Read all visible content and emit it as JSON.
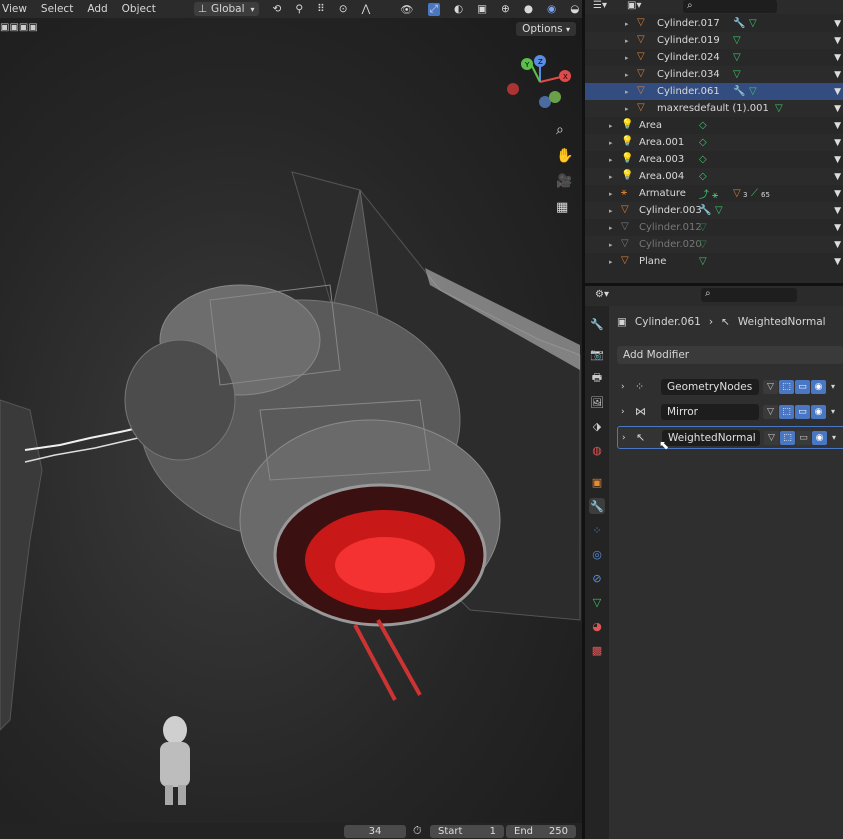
{
  "viewport": {
    "menu": [
      "View",
      "Select",
      "Add",
      "Object"
    ],
    "orientation": "Global",
    "options_label": "Options",
    "gizmo_axes": [
      "Y",
      "Z",
      "X"
    ]
  },
  "timeline": {
    "current_frame": "34",
    "start_label": "Start",
    "start_value": "1",
    "end_label": "End",
    "end_value": "250"
  },
  "outliner": {
    "rows": [
      {
        "label": "Cylinder.017",
        "type": "mesh",
        "extras": "wrench"
      },
      {
        "label": "Cylinder.019",
        "type": "mesh",
        "extras": ""
      },
      {
        "label": "Cylinder.024",
        "type": "mesh",
        "extras": ""
      },
      {
        "label": "Cylinder.034",
        "type": "mesh",
        "extras": ""
      },
      {
        "label": "Cylinder.061",
        "type": "mesh",
        "extras": "wrench",
        "selected": true
      },
      {
        "label": "maxresdefault (1).001",
        "type": "mesh",
        "extras": ""
      },
      {
        "label": "Area",
        "type": "light",
        "extras": ""
      },
      {
        "label": "Area.001",
        "type": "light",
        "extras": ""
      },
      {
        "label": "Area.003",
        "type": "light",
        "extras": ""
      },
      {
        "label": "Area.004",
        "type": "light",
        "extras": ""
      },
      {
        "label": "Armature",
        "type": "armature",
        "extras": "3",
        "extras2": "65"
      },
      {
        "label": "Cylinder.003",
        "type": "mesh",
        "extras": "wrench"
      },
      {
        "label": "Cylinder.012",
        "type": "mesh",
        "extras": "",
        "dim": true
      },
      {
        "label": "Cylinder.020",
        "type": "mesh",
        "extras": "",
        "dim": true
      },
      {
        "label": "Plane",
        "type": "mesh",
        "extras": ""
      }
    ]
  },
  "properties": {
    "breadcrumb_object": "Cylinder.061",
    "breadcrumb_modifier": "WeightedNormal",
    "add_modifier_label": "Add Modifier",
    "modifiers": [
      {
        "name": "GeometryNodes"
      },
      {
        "name": "Mirror"
      },
      {
        "name": "WeightedNormal"
      }
    ]
  },
  "colors": {
    "accent": "#4a77c4",
    "selected_row": "#334d80",
    "mesh_icon": "#d4803a",
    "data_icon": "#3ec46d"
  }
}
